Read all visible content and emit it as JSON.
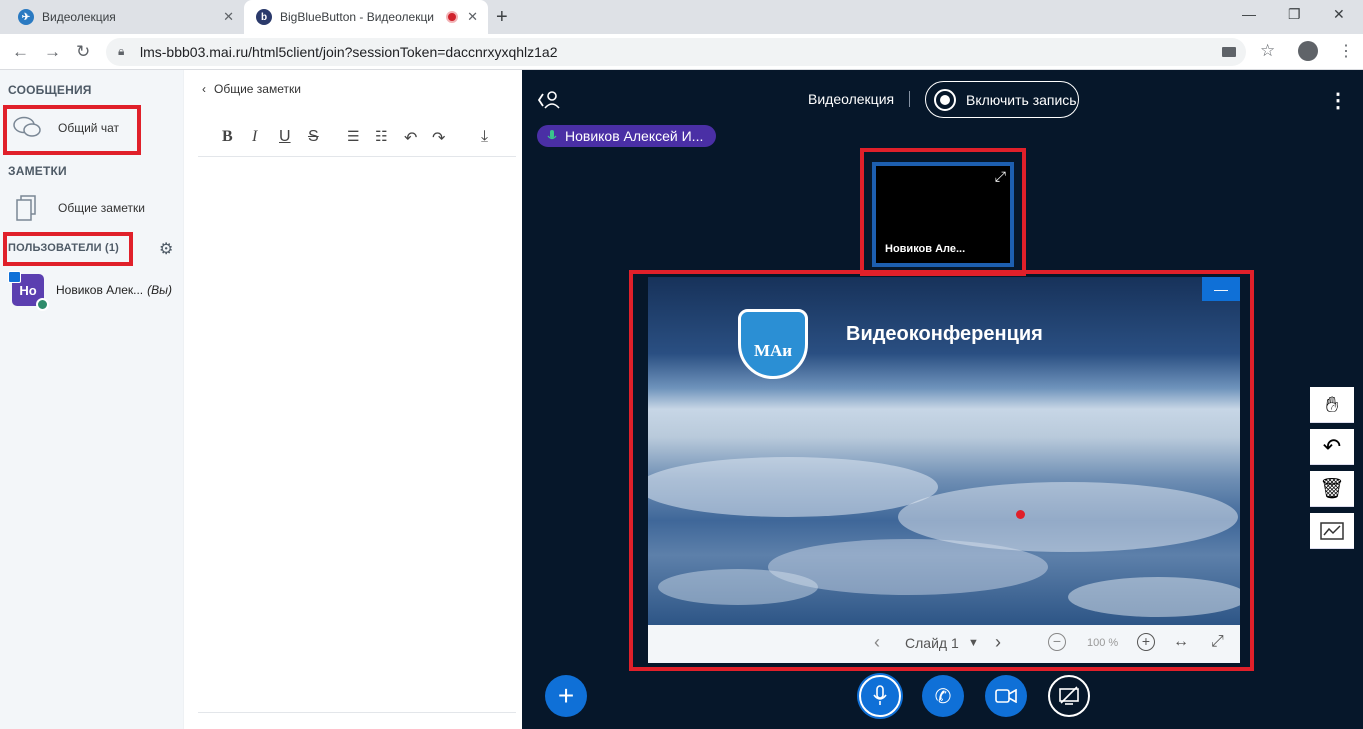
{
  "browser": {
    "tabs": [
      {
        "title": "Видеолекция"
      },
      {
        "title": "BigBlueButton - Видеолекци"
      }
    ],
    "url": "lms-bbb03.mai.ru/html5client/join?sessionToken=daccnrxyxqhlz1a2"
  },
  "sidebar": {
    "messages_heading": "СООБЩЕНИЯ",
    "public_chat": "Общий чат",
    "notes_heading": "ЗАМЕТКИ",
    "shared_notes": "Общие заметки",
    "users_heading": "ПОЛЬЗОВАТЕЛИ (1)",
    "user": {
      "avatar": "Но",
      "name": "Новиков Алек...",
      "you": "(Вы)",
      "avatar_color": "#5b3fb0"
    }
  },
  "notes": {
    "back_label": "Общие заметки",
    "tools": [
      "B",
      "I",
      "U",
      "S"
    ]
  },
  "main": {
    "meeting_title": "Видеолекция",
    "record_label": "Включить запись",
    "talker": "Новиков Алексей И...",
    "webcam_name": "Новиков Але...",
    "slide_title": "Видеоконференция",
    "logo_text": "МАи",
    "slide_label": "Слайд 1",
    "zoom": "100 %"
  },
  "colors": {
    "accent": "#0f70d7",
    "dark_bg": "#06172a",
    "highlight": "#e0202a",
    "talker": "#4a2fa5"
  }
}
